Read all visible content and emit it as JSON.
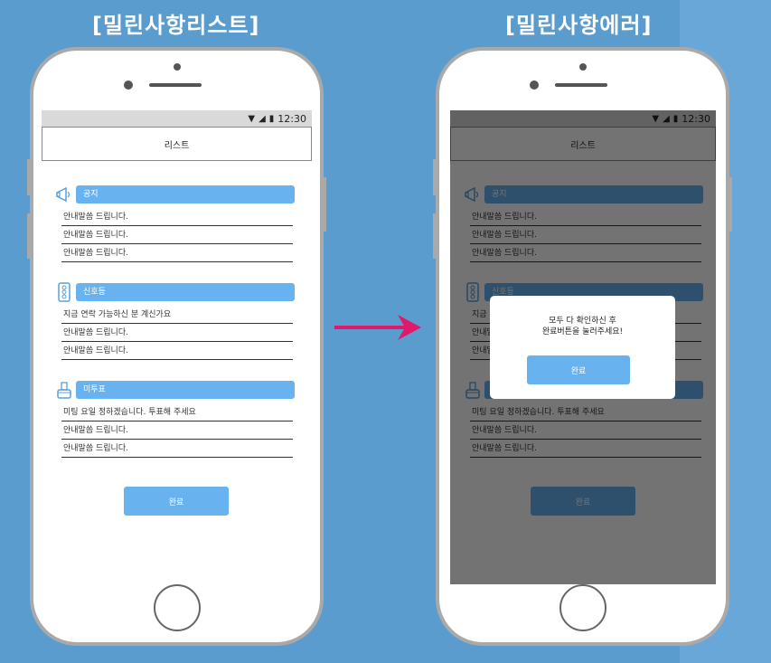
{
  "captions": {
    "left": "[밀린사항리스트]",
    "right": "[밀린사항에러]"
  },
  "statusbar": {
    "time": "12:30"
  },
  "appbar": {
    "title": "리스트"
  },
  "sections": [
    {
      "title": "공지",
      "icon": "megaphone-icon",
      "rows": [
        "안내말씀 드립니다.",
        "안내말씀 드립니다.",
        "안내말씀 드립니다."
      ]
    },
    {
      "title": "신호등",
      "icon": "traffic-light-icon",
      "rows": [
        "지금 연락 가능하신 분 계신가요",
        "안내말씀 드립니다.",
        "안내말씀 드립니다."
      ]
    },
    {
      "title": "미투표",
      "icon": "ballot-box-icon",
      "rows": [
        "미팅 요일 정하겠습니다. 투표해 주세요",
        "안내말씀 드립니다.",
        "안내말씀 드립니다."
      ]
    }
  ],
  "done_button": "완료",
  "dialog": {
    "line1": "모두 다 확인하신 후",
    "line2": "완료버튼을 눌러주세요!",
    "ok_label": "완료"
  },
  "colors": {
    "background": "#5b9ccf",
    "accent": "#68b2f0",
    "arrow": "#e0196b"
  }
}
